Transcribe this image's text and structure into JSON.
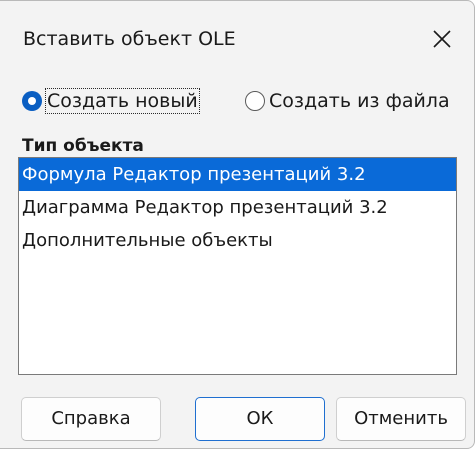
{
  "window": {
    "title": "Вставить объект OLE"
  },
  "mode": {
    "options": [
      {
        "label": "Создать новый",
        "checked": true
      },
      {
        "label": "Создать из файла",
        "checked": false
      }
    ]
  },
  "object_type": {
    "label": "Тип объекта",
    "items": [
      {
        "label": "Формула Редактор презентаций 3.2",
        "selected": true
      },
      {
        "label": "Диаграмма Редактор презентаций 3.2",
        "selected": false
      },
      {
        "label": "Дополнительные объекты",
        "selected": false
      }
    ]
  },
  "buttons": {
    "help": "Справка",
    "ok": "ОК",
    "cancel": "Отменить"
  },
  "colors": {
    "accent": "#0a6ad8",
    "radio_checked": "#0a5ec2"
  }
}
